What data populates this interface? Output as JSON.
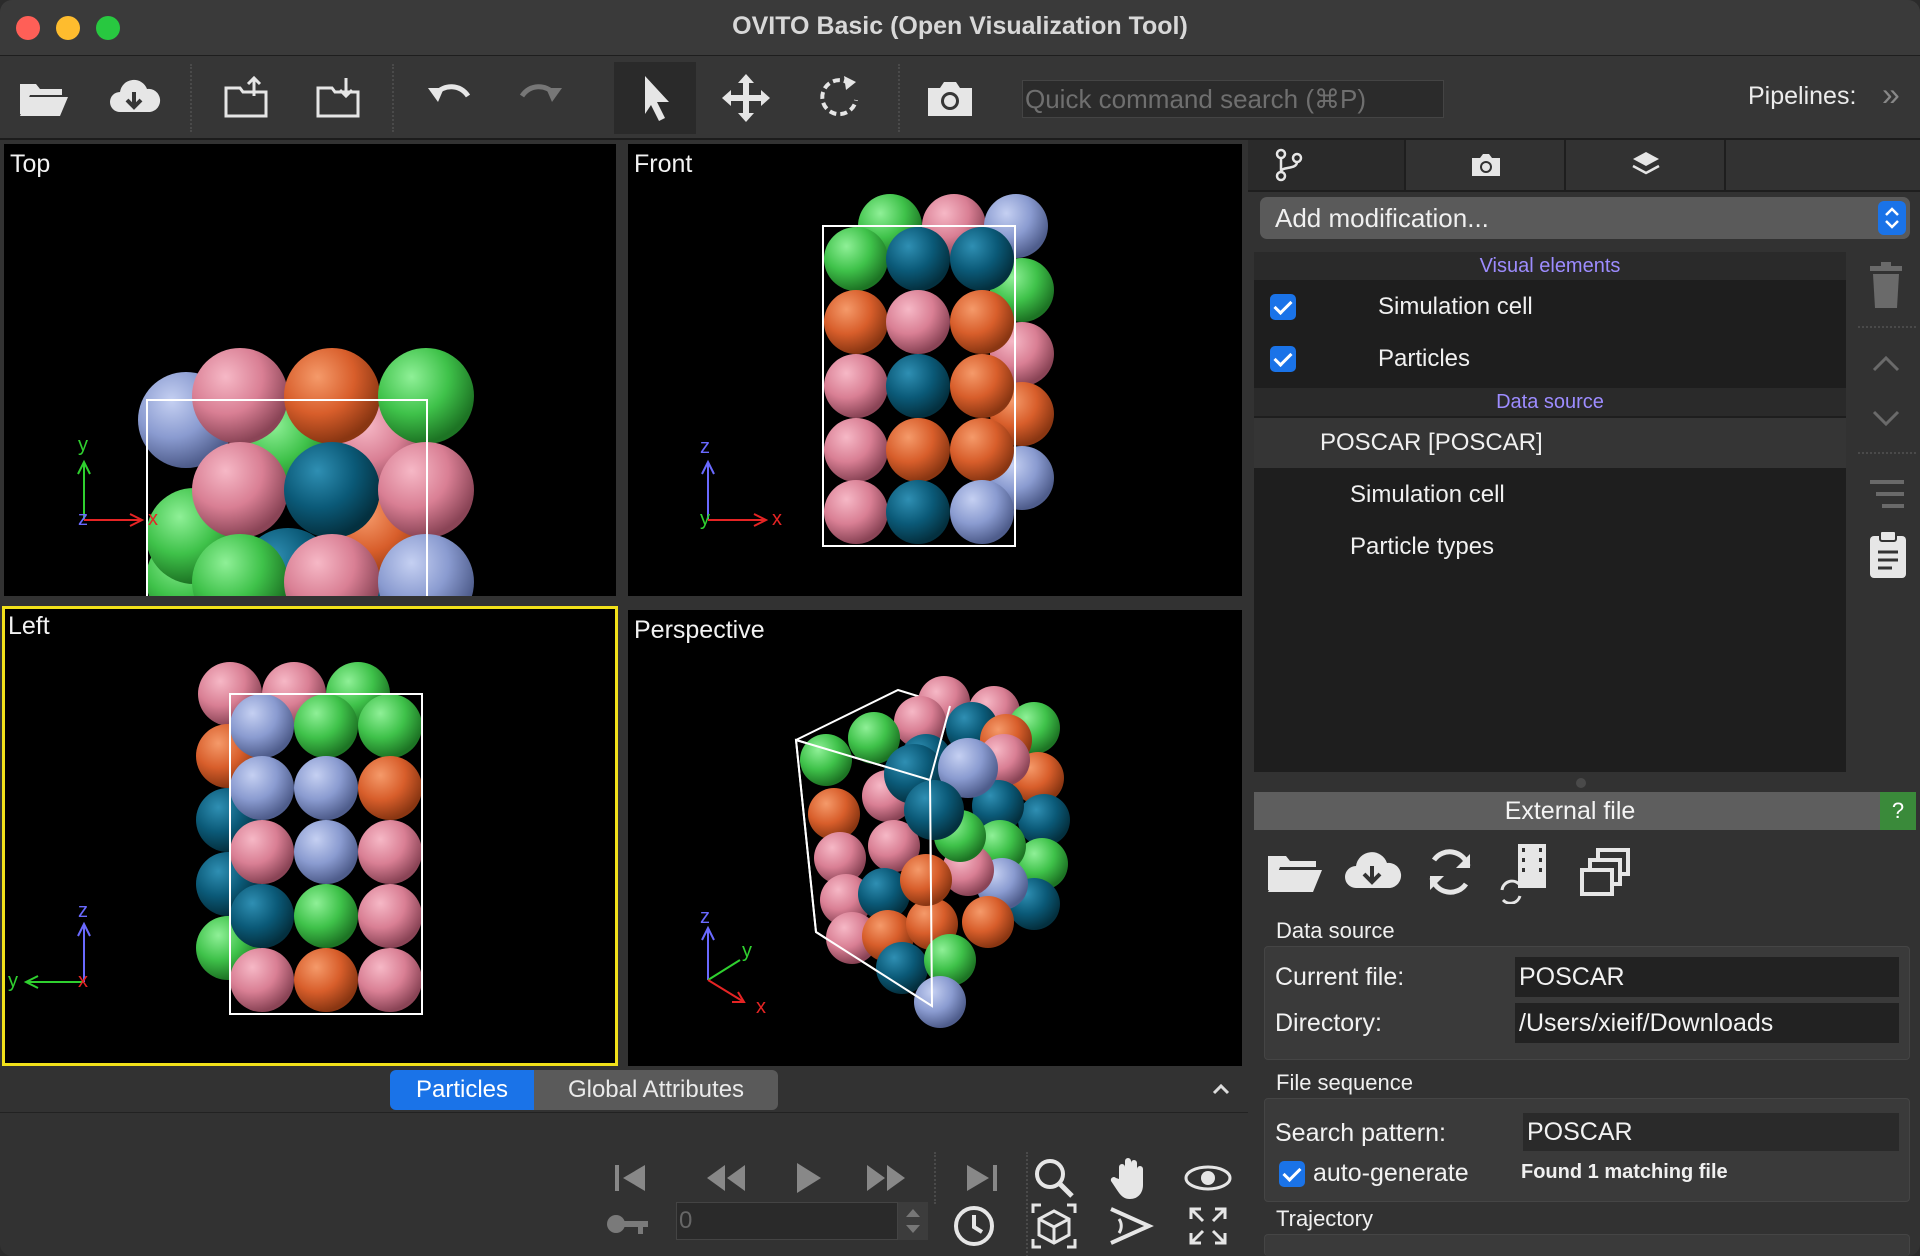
{
  "window": {
    "title": "OVITO Basic (Open Visualization Tool)",
    "traffic_colors": [
      "#ff5f57",
      "#febc2e",
      "#28c840"
    ]
  },
  "toolbar": {
    "buttons": [
      {
        "name": "open-folder-icon"
      },
      {
        "name": "download-cloud-icon"
      },
      {
        "name": "export-file-icon"
      },
      {
        "name": "import-file-icon"
      },
      {
        "name": "undo-icon"
      },
      {
        "name": "redo-icon"
      },
      {
        "name": "select-cursor-icon"
      },
      {
        "name": "move-icon"
      },
      {
        "name": "rotate-icon"
      },
      {
        "name": "camera-icon"
      }
    ],
    "search_placeholder": "Quick command search (⌘P)",
    "pipelines_label": "Pipelines:",
    "pipelines_more": "»"
  },
  "viewports": {
    "top": {
      "label": "Top",
      "axis_labels": [
        "y",
        "z",
        "x"
      ]
    },
    "front": {
      "label": "Front",
      "axis_labels": [
        "z",
        "y",
        "x"
      ]
    },
    "left": {
      "label": "Left",
      "axis_labels": [
        "z",
        "y",
        "x"
      ]
    },
    "perspective": {
      "label": "Perspective",
      "axis_labels": [
        "z",
        "y",
        "x"
      ]
    }
  },
  "colors": {
    "pink": "#d97f94",
    "orange": "#d85e2b",
    "green": "#3fc24a",
    "teal": "#0b5a78",
    "lavender": "#8a9bd0",
    "accent_blue": "#1a73e8",
    "active_viewport": "#f2e11a"
  },
  "bottom": {
    "tabs": [
      "Particles",
      "Global Attributes"
    ],
    "frame_value": "0"
  },
  "pipeline_panel": {
    "add_modification": "Add modification...",
    "visual_elements_header": "Visual elements",
    "visual_elements": [
      "Simulation cell",
      "Particles"
    ],
    "data_source_header": "Data source",
    "data_source_root": "POSCAR [POSCAR]",
    "data_source_children": [
      "Simulation cell",
      "Particle types"
    ]
  },
  "external_file": {
    "header": "External file",
    "help": "?",
    "data_source_title": "Data source",
    "current_file_label": "Current file:",
    "current_file_value": "POSCAR",
    "directory_label": "Directory:",
    "directory_value": "/Users/xieif/Downloads",
    "file_sequence_title": "File sequence",
    "search_pattern_label": "Search pattern:",
    "search_pattern_value": "POSCAR",
    "auto_generate_label": "auto-generate",
    "found_text": "Found 1 matching file",
    "trajectory_title": "Trajectory"
  }
}
